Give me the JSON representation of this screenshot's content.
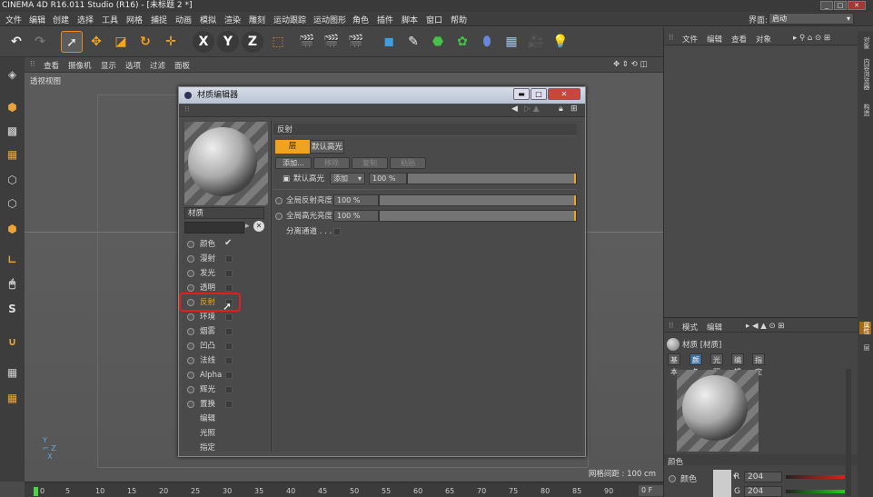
{
  "app": {
    "title": "CINEMA 4D R16.011 Studio (R16) - [未标题 2 *]"
  },
  "menu": [
    "文件",
    "编辑",
    "创建",
    "选择",
    "工具",
    "网格",
    "捕捉",
    "动画",
    "模拟",
    "渲染",
    "雕刻",
    "运动跟踪",
    "运动图形",
    "角色",
    "插件",
    "脚本",
    "窗口",
    "帮助"
  ],
  "layout": {
    "label": "界面:",
    "value": "启动"
  },
  "viewport_menu": [
    "查看",
    "摄像机",
    "显示",
    "选项",
    "过滤",
    "面板"
  ],
  "viewport": {
    "label": "透视视图",
    "grid_spacing": "网格间距 : 100 cm"
  },
  "timeline": {
    "ticks": [
      "0",
      "5",
      "10",
      "15",
      "20",
      "25",
      "30",
      "35",
      "40",
      "45",
      "50",
      "55",
      "60",
      "65",
      "70",
      "75",
      "80",
      "85",
      "90"
    ],
    "frame": "0 F"
  },
  "object_manager": {
    "menu": [
      "文件",
      "编辑",
      "查看",
      "对象"
    ]
  },
  "side_tabs": [
    "对象",
    "内容浏览器",
    "构造",
    "属性",
    "层"
  ],
  "attributes": {
    "menu": [
      "模式",
      "编辑"
    ],
    "material_title": "材质 [材质]",
    "tabs": [
      "基本",
      "颜色",
      "光照",
      "编辑",
      "指定"
    ],
    "active_tab": "颜色",
    "section": "颜色",
    "color_label": "颜色",
    "r_label": "R",
    "r_value": "204",
    "g_label": "G",
    "g_value": "204"
  },
  "dialog": {
    "title": "材质编辑器",
    "material_name": "材质",
    "channels": [
      {
        "label": "颜色",
        "checked": true
      },
      {
        "label": "漫射",
        "checked": false
      },
      {
        "label": "发光",
        "checked": false
      },
      {
        "label": "透明",
        "checked": false
      },
      {
        "label": "反射",
        "checked": false,
        "selected": true
      },
      {
        "label": "环境",
        "checked": false
      },
      {
        "label": "烟雾",
        "checked": false
      },
      {
        "label": "凹凸",
        "checked": false
      },
      {
        "label": "法线",
        "checked": false
      },
      {
        "label": "Alpha",
        "checked": false
      },
      {
        "label": "辉光",
        "checked": false
      },
      {
        "label": "置换",
        "checked": false
      },
      {
        "label": "编辑"
      },
      {
        "label": "光照"
      },
      {
        "label": "指定"
      }
    ],
    "reflectance": {
      "title": "反射",
      "layer_btn": "层",
      "default_spec_btn": "默认高光",
      "buttons": [
        "添加...",
        "移除",
        "复制",
        "粘贴"
      ],
      "default_spec_label": "默认高光",
      "blend_mode": "添加",
      "blend_value": "100 %",
      "global_refl_label": "全局反射亮度",
      "global_refl_value": "100 %",
      "global_spec_label": "全局高光亮度",
      "global_spec_value": "100 %",
      "separate_pass_label": "分离通道 . . . ."
    }
  },
  "colors": {
    "accent": "#f0a31e",
    "highlight_box": "#e0201e"
  }
}
